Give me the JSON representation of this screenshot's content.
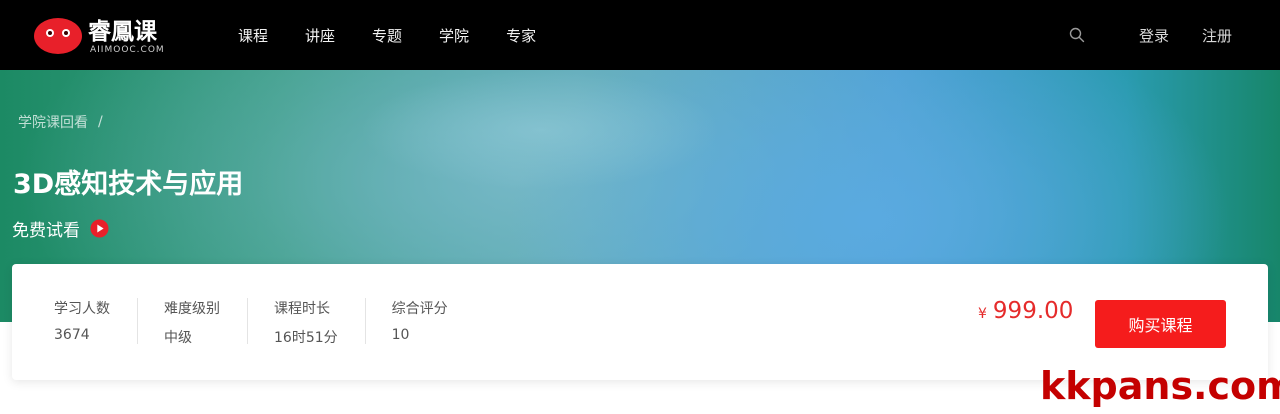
{
  "brand": {
    "name": "睿鳳课",
    "sub": "AIIMOOC.COM",
    "logo_color": "#e8202a"
  },
  "nav": {
    "items": [
      {
        "label": "课程"
      },
      {
        "label": "讲座"
      },
      {
        "label": "专题"
      },
      {
        "label": "学院"
      },
      {
        "label": "专家"
      }
    ],
    "login_label": "登录",
    "register_label": "注册",
    "search_icon": "search-icon"
  },
  "hero": {
    "breadcrumb": "学院课回看",
    "breadcrumb_sep": "/",
    "title": "3D感知技术与应用",
    "free_trial_label": "免费试看",
    "play_icon": "play-circle-icon"
  },
  "course_info": {
    "stats": [
      {
        "label": "学习人数",
        "value": "3674"
      },
      {
        "label": "难度级别",
        "value": "中级"
      },
      {
        "label": "课程时长",
        "value": "16时51分"
      },
      {
        "label": "综合评分",
        "value": "10"
      }
    ],
    "currency": "¥",
    "price": "999.00",
    "buy_label": "购买课程",
    "accent_color": "#f51c1c"
  },
  "watermark": "kkpans.com"
}
